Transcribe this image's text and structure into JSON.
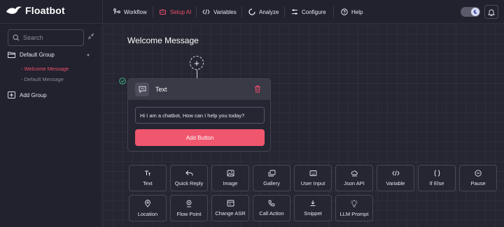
{
  "brand": {
    "name": "Floatbot"
  },
  "nav": {
    "items": [
      {
        "label": "Workflow",
        "icon": "workflow-icon"
      },
      {
        "label": "Setup AI",
        "icon": "setup-ai-icon",
        "active": true
      },
      {
        "label": "Variables",
        "icon": "code-icon"
      },
      {
        "label": "Analyze",
        "icon": "analyze-icon"
      },
      {
        "label": "Configure",
        "icon": "sliders-icon"
      },
      {
        "label": "Help",
        "icon": "help-icon"
      }
    ],
    "theme_toggle_icon": "moon-icon",
    "notification_icon": "bell-icon"
  },
  "sidebar": {
    "search_placeholder": "Search",
    "group": {
      "label": "Default Group",
      "items": [
        "- Welcome Message",
        "- Default Message"
      ]
    },
    "add_group_label": "Add Group"
  },
  "canvas": {
    "title": "Welcome Message",
    "card": {
      "title": "Text",
      "message": "Hi I am a chatbot, How can I help you today?",
      "button_label": "Add Button"
    },
    "palette": [
      "Text",
      "Quick Reply",
      "Image",
      "Gallery",
      "User Input",
      "Json API",
      "Variable",
      "If Else",
      "Pause",
      "Location",
      "Flow Point",
      "Change ASR",
      "Call Action",
      "Snippet",
      "LLM Prompt"
    ]
  },
  "colors": {
    "accent": "#f0566e",
    "background": "#262632",
    "success": "#3fb27f"
  }
}
